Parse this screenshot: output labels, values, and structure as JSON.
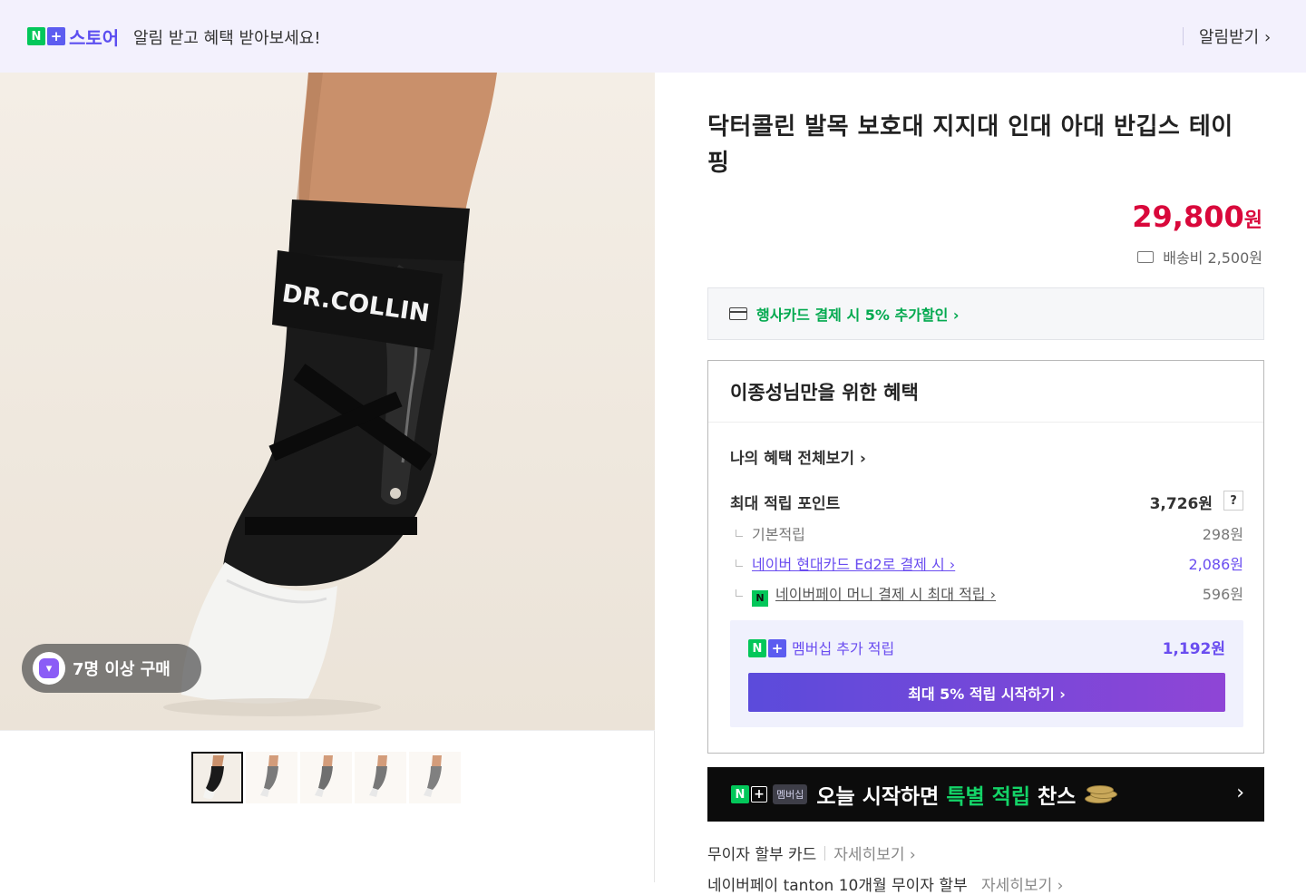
{
  "banner": {
    "store_label": "스토어",
    "message": "알림 받고 혜택 받아보세요!",
    "notify_label": "알림받기 ›"
  },
  "gallery": {
    "image_text": "DR.COLLIN",
    "purchase_badge": "7명 이상 구매",
    "thumbnail_count": 5
  },
  "product": {
    "title": "닥터콜린 발목 보호대 지지대 인대 아대 반깁스 테이핑",
    "price": "29,800",
    "price_unit": "원",
    "shipping": "배송비 2,500원",
    "card_promo": "행사카드 결제 시 5% 추가할인 ›"
  },
  "benefit": {
    "heading": "이종성님만을 위한 혜택",
    "all_view": "나의 혜택 전체보기 ›",
    "max_point_label": "최대 적립 포인트",
    "max_point_value": "3,726원",
    "help": "?",
    "items": [
      {
        "label": "기본적립",
        "value": "298원"
      },
      {
        "label": "네이버 현대카드 Ed2로 결제 시 ›",
        "value": "2,086원"
      },
      {
        "label": "네이버페이 머니 결제 시 최대 적립 ›",
        "value": "596원"
      }
    ],
    "membership_label": "멤버십 추가 적립",
    "membership_value": "1,192원",
    "membership_button": "최대 5% 적립 시작하기 ›"
  },
  "member_banner": {
    "tag": "멤버십",
    "text_a": "오늘 시작하면 ",
    "text_b": "특별 적립",
    "text_c": " 찬스",
    "chevron": "›"
  },
  "installment": {
    "label": "무이자 할부 카드",
    "more": "자세히보기 ›",
    "label2": "네이버페이 tanton 10개월 무이자 할부",
    "more2": "자세히보기 ›"
  },
  "colors": {
    "price": "#d9083b",
    "naver_green": "#03c75a",
    "accent_purple": "#6a4df0"
  }
}
